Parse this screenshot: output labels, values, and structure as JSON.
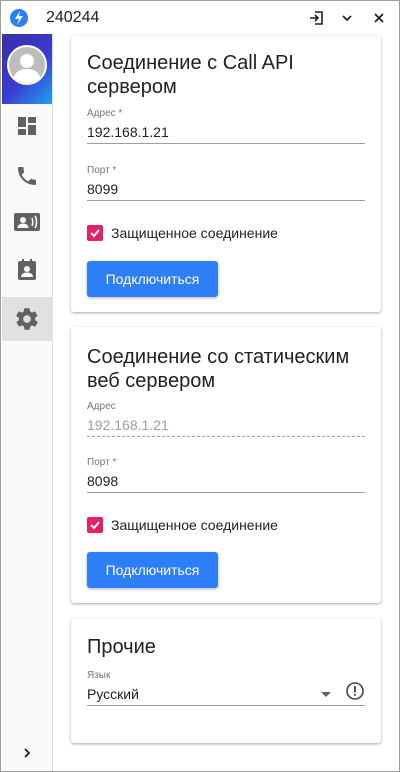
{
  "window": {
    "title": "240244"
  },
  "colors": {
    "accent": "#2d7ff9",
    "checkbox": "#e91e63"
  },
  "titlebar": {
    "icons": [
      "lightning-icon",
      "exit-icon",
      "chevron-down-icon",
      "close-icon"
    ]
  },
  "sidebar": {
    "items": [
      {
        "icon": "dashboard-icon"
      },
      {
        "icon": "phone-icon"
      },
      {
        "icon": "contact-card-icon"
      },
      {
        "icon": "contacts-book-icon"
      },
      {
        "icon": "gear-icon",
        "active": true
      }
    ],
    "expand_icon": "chevron-right-icon"
  },
  "call_api": {
    "title": "Соединение с Call API сервером",
    "address_label": "Адрес *",
    "address_value": "192.168.1.21",
    "port_label": "Порт *",
    "port_value": "8099",
    "secure_label": "Защищенное соединение",
    "secure_checked": true,
    "connect_label": "Подключиться"
  },
  "static_web": {
    "title": "Соединение со статическим веб сервером",
    "address_label": "Адрес",
    "address_value": "192.168.1.21",
    "port_label": "Порт *",
    "port_value": "8098",
    "secure_label": "Защищенное соединение",
    "secure_checked": true,
    "connect_label": "Подключиться"
  },
  "other": {
    "title": "Прочие",
    "language_label": "Язык",
    "language_value": "Русский"
  }
}
